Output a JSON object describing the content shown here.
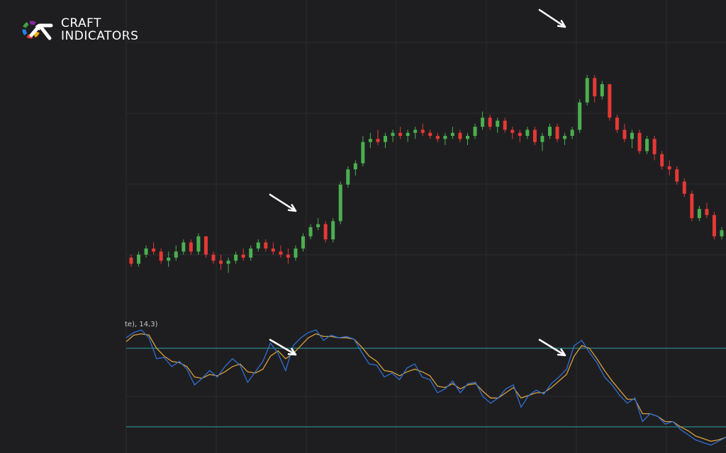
{
  "brand": {
    "line1": "CRAFT",
    "line2": "INDICATORS",
    "text_color": "#ffffff",
    "mark_colors": [
      "#f7b500",
      "#e53935",
      "#1e88e5",
      "#43a047",
      "#8e24aa",
      "#ffffff"
    ]
  },
  "indicator": {
    "label": "te), 14,3)",
    "fast_color": "#2f6fd6",
    "slow_color": "#d9a03a",
    "level_color": "#2aa3a3",
    "levels": [
      80,
      20
    ]
  },
  "colors": {
    "background": "#1e1e20",
    "grid": "#2c2c30",
    "up": "#4caf50",
    "down": "#e53935",
    "arrow": "#ffffff"
  },
  "chart_data": {
    "type": "candlestick",
    "price": {
      "ylim": [
        0,
        100
      ],
      "candles": [
        [
          20,
          21,
          17,
          18
        ],
        [
          18,
          22,
          17,
          21
        ],
        [
          21,
          24,
          20,
          23
        ],
        [
          23,
          25,
          21,
          22
        ],
        [
          22,
          23,
          18,
          19
        ],
        [
          19,
          22,
          17,
          20
        ],
        [
          20,
          24,
          19,
          22
        ],
        [
          22,
          26,
          21,
          25
        ],
        [
          25,
          26,
          21,
          22
        ],
        [
          22,
          28,
          21,
          27
        ],
        [
          27,
          27,
          20,
          21
        ],
        [
          21,
          22,
          18,
          19
        ],
        [
          19,
          21,
          16,
          18
        ],
        [
          18,
          20,
          15,
          19
        ],
        [
          19,
          22,
          18,
          21
        ],
        [
          21,
          23,
          19,
          20
        ],
        [
          20,
          24,
          19,
          23
        ],
        [
          23,
          26,
          22,
          25
        ],
        [
          25,
          26,
          22,
          23
        ],
        [
          23,
          25,
          21,
          22
        ],
        [
          22,
          24,
          20,
          21
        ],
        [
          21,
          23,
          18,
          20
        ],
        [
          20,
          24,
          19,
          23
        ],
        [
          23,
          28,
          22,
          27
        ],
        [
          27,
          31,
          26,
          30
        ],
        [
          30,
          33,
          29,
          31
        ],
        [
          31,
          32,
          25,
          26
        ],
        [
          26,
          33,
          25,
          32
        ],
        [
          32,
          45,
          31,
          44
        ],
        [
          44,
          50,
          43,
          49
        ],
        [
          49,
          52,
          47,
          51
        ],
        [
          51,
          60,
          50,
          58
        ],
        [
          58,
          61,
          56,
          59
        ],
        [
          59,
          62,
          57,
          58
        ],
        [
          58,
          61,
          56,
          60
        ],
        [
          60,
          62,
          58,
          61
        ],
        [
          61,
          63,
          59,
          60
        ],
        [
          60,
          62,
          58,
          61
        ],
        [
          61,
          63,
          59,
          62
        ],
        [
          62,
          64,
          60,
          61
        ],
        [
          61,
          62,
          59,
          60
        ],
        [
          60,
          61,
          58,
          59
        ],
        [
          59,
          61,
          57,
          60
        ],
        [
          60,
          63,
          59,
          61
        ],
        [
          61,
          62,
          58,
          59
        ],
        [
          59,
          61,
          57,
          60
        ],
        [
          60,
          64,
          59,
          63
        ],
        [
          63,
          68,
          62,
          66
        ],
        [
          66,
          67,
          62,
          63
        ],
        [
          63,
          66,
          61,
          65
        ],
        [
          65,
          66,
          61,
          62
        ],
        [
          62,
          63,
          59,
          61
        ],
        [
          61,
          62,
          58,
          60
        ],
        [
          60,
          63,
          59,
          62
        ],
        [
          62,
          63,
          57,
          58
        ],
        [
          58,
          61,
          55,
          60
        ],
        [
          60,
          64,
          59,
          63
        ],
        [
          63,
          64,
          58,
          59
        ],
        [
          59,
          61,
          57,
          60
        ],
        [
          60,
          63,
          59,
          62
        ],
        [
          62,
          72,
          61,
          71
        ],
        [
          71,
          80,
          70,
          79
        ],
        [
          79,
          80,
          71,
          73
        ],
        [
          73,
          78,
          72,
          77
        ],
        [
          77,
          77,
          65,
          66
        ],
        [
          66,
          67,
          61,
          62
        ],
        [
          62,
          64,
          58,
          59
        ],
        [
          59,
          62,
          56,
          61
        ],
        [
          61,
          62,
          54,
          55
        ],
        [
          55,
          60,
          54,
          59
        ],
        [
          59,
          60,
          52,
          54
        ],
        [
          54,
          55,
          49,
          50
        ],
        [
          50,
          52,
          47,
          49
        ],
        [
          49,
          50,
          44,
          45
        ],
        [
          45,
          46,
          40,
          41
        ],
        [
          41,
          42,
          32,
          33
        ],
        [
          33,
          37,
          32,
          36
        ],
        [
          36,
          38,
          33,
          34
        ],
        [
          34,
          35,
          26,
          27
        ],
        [
          27,
          30,
          26,
          29
        ]
      ]
    },
    "oscillator": {
      "ylim": [
        0,
        100
      ],
      "levels": [
        80,
        20
      ],
      "k": [
        88,
        92,
        94,
        88,
        72,
        73,
        66,
        70,
        64,
        52,
        57,
        63,
        58,
        66,
        72,
        67,
        54,
        62,
        70,
        84,
        76,
        63,
        82,
        88,
        92,
        94,
        86,
        90,
        88,
        89,
        87,
        77,
        68,
        67,
        58,
        61,
        56,
        65,
        68,
        58,
        56,
        46,
        49,
        55,
        46,
        53,
        54,
        43,
        38,
        42,
        49,
        52,
        35,
        44,
        48,
        45,
        53,
        58,
        64,
        82,
        86,
        77,
        69,
        58,
        52,
        44,
        38,
        42,
        24,
        30,
        28,
        22,
        24,
        18,
        14,
        10,
        8,
        6,
        9,
        12
      ],
      "d": [
        85,
        90,
        91,
        90,
        80,
        74,
        70,
        69,
        66,
        58,
        57,
        60,
        59,
        62,
        66,
        68,
        62,
        61,
        64,
        74,
        78,
        72,
        76,
        82,
        88,
        91,
        89,
        89,
        88,
        88,
        87,
        81,
        74,
        70,
        63,
        62,
        59,
        62,
        64,
        62,
        59,
        51,
        50,
        53,
        49,
        52,
        53,
        47,
        42,
        42,
        46,
        50,
        42,
        44,
        46,
        46,
        50,
        55,
        60,
        74,
        82,
        80,
        72,
        63,
        55,
        48,
        41,
        41,
        30,
        30,
        28,
        24,
        24,
        20,
        17,
        13,
        11,
        9,
        10,
        12
      ]
    },
    "annotations": [
      "arrow",
      "arrow",
      "arrow",
      "arrow"
    ]
  }
}
